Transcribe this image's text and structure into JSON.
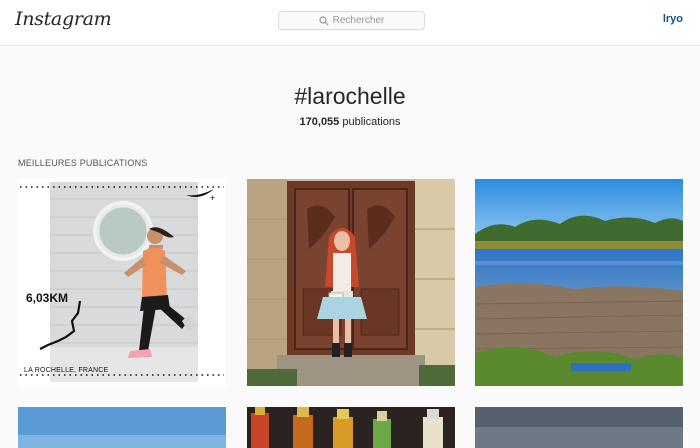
{
  "header": {
    "logo_text": "Instagram",
    "search_placeholder": "Rechercher",
    "username": "lryo"
  },
  "hashtag": {
    "title": "#larochelle",
    "count": "170,055",
    "count_suffix": "publications"
  },
  "section": {
    "title": "MEILLEURES PUBLICATIONS"
  },
  "posts": [
    {
      "overlay_distance": "6,03KM",
      "overlay_location": "LA ROCHELLE, FRANCE"
    },
    {},
    {}
  ],
  "colors": {
    "link": "#125688",
    "background": "#fafafa",
    "border": "#e6e6e6"
  }
}
